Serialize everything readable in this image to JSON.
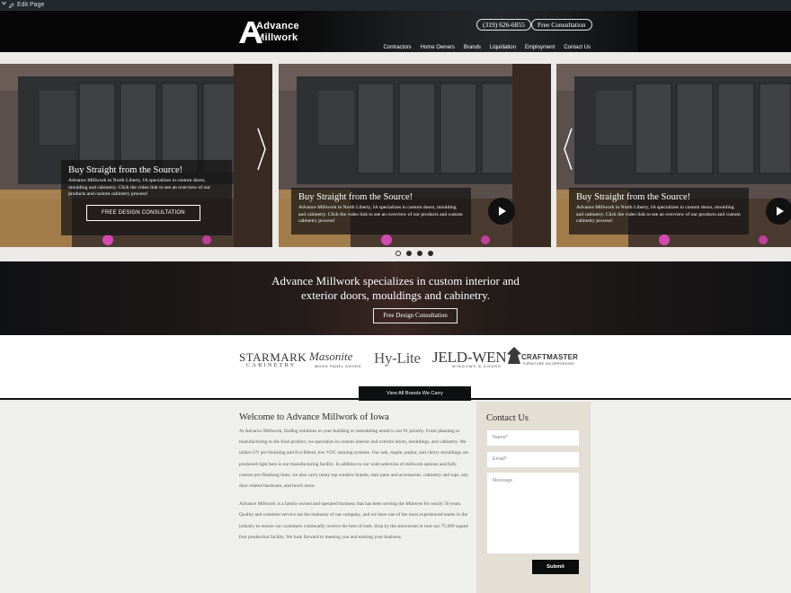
{
  "adminbar": {
    "edit_label": "Edit Page"
  },
  "header": {
    "logo_line1": "Advance",
    "logo_line2": "Millwork",
    "phone": "(319) 626-6855",
    "consult": "Free Consultation",
    "nav": [
      "Contractors",
      "Home Owners",
      "Brands",
      "Liquidation",
      "Employment",
      "Contact Us"
    ]
  },
  "slides": [
    {
      "title": "Buy Straight from the Source!",
      "text": "Advance Millwork in North Liberty, IA specializes in custom doors, moulding and cabinetry. Click the video link to see an overview of our products and custom cabinetry process!",
      "button": "FREE DESIGN CONSULTATION"
    },
    {
      "title": "Buy Straight from the Source!",
      "text": "Advance Millwork in North Liberty, IA specializes in custom doors, moulding and cabinetry. Click the video link to see an overview of our products and custom cabinetry process!"
    },
    {
      "title": "Buy Straight from the Source!",
      "text": "Advance Millwork in North Liberty, IA specializes in custom doors, moulding and cabinetry. Click the video link to see an overview of our products and custom cabinetry process!"
    }
  ],
  "banner": {
    "text_line1": "Advance Millwork specializes in custom interior and",
    "text_line2": "exterior doors, mouldings and cabinetry.",
    "button": "Free Design Consultation"
  },
  "brands": {
    "starmark": "STARMARK",
    "starmark_sub": "CABINETRY",
    "masonite": "Masonite",
    "masonite_sub": "WOOD PANEL DOORS",
    "hylite": "Hy-Lite",
    "jeldwen": "JELD-WEN",
    "jeldwen_sub": "WINDOWS & DOORS",
    "craftmaster": "CRAFTMASTER",
    "craftmaster_sub": "FURNITURE INCORPORATED",
    "view_all": "View All Brands We Carry"
  },
  "welcome": {
    "title": "Welcome to Advance Millwork of Iowa",
    "p1": "At Advance Millwork, finding solutions to your building or remodeling needs is our #1 priority. From planning to manufacturing to the final product, we specialize in custom interior and exterior doors, mouldings, and cabinetry. We utilize UV pre-finishing and Eco Blend, low VOC staining systems. Our oak, maple, poplar, and cherry mouldings are produced right here is our manufacturing facility. In addition to our wide selection of millwork options and fully custom pre-finishing lines, we also carry many top window brands, stair parts and accessories, cabinetry and tops, any door related hardware, and much more.",
    "p2": "Advance Millwork is a family owned and operated business that has been serving the Midwest for nearly 50 years. Quality and customer service are the mainstay of our company, and we have one of the most experienced teams in the industry to ensure our customers continually receive the best of both. Stop by the showroom or tour our 75,000 square foot production facility. We look forward to meeting you and earning your business."
  },
  "contact": {
    "title": "Contact Us",
    "name_placeholder": "Name*",
    "email_placeholder": "Email*",
    "message_placeholder": "Message",
    "submit": "Submit"
  },
  "slider_dots": {
    "count": 4,
    "active": 1
  }
}
